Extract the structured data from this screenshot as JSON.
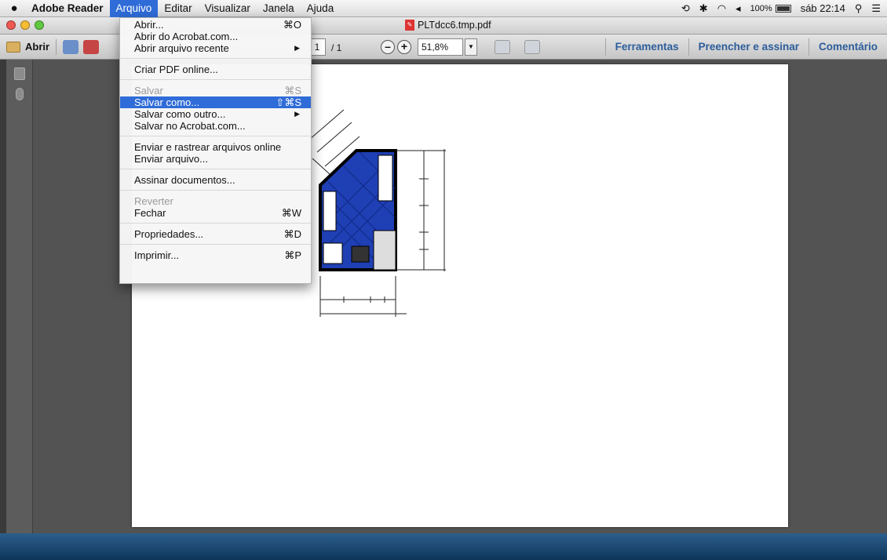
{
  "menubar": {
    "app_name": "Adobe Reader",
    "menus": [
      "Arquivo",
      "Editar",
      "Visualizar",
      "Janela",
      "Ajuda"
    ],
    "status": {
      "battery": "100%",
      "clock": "sáb 22:14"
    }
  },
  "window": {
    "title": "PLTdcc6.tmp.pdf"
  },
  "toolbar": {
    "open_label": "Abrir",
    "page_current": "1",
    "page_total": "/ 1",
    "zoom": "51,8%",
    "links": [
      "Ferramentas",
      "Preencher e assinar",
      "Comentário"
    ]
  },
  "file_menu": {
    "items": [
      {
        "label": "Abrir...",
        "shortcut": "⌘O"
      },
      {
        "label": "Abrir do Acrobat.com...",
        "shortcut": ""
      },
      {
        "label": "Abrir arquivo recente",
        "shortcut": ""
      },
      {
        "label": "Criar PDF online...",
        "shortcut": ""
      },
      {
        "label": "Salvar",
        "shortcut": "⌘S"
      },
      {
        "label": "Salvar como...",
        "shortcut": "⇧⌘S"
      },
      {
        "label": "Salvar como outro...",
        "shortcut": ""
      },
      {
        "label": "Salvar no Acrobat.com...",
        "shortcut": ""
      },
      {
        "label": "Enviar e rastrear arquivos online",
        "shortcut": ""
      },
      {
        "label": "Enviar arquivo...",
        "shortcut": ""
      },
      {
        "label": "Assinar documentos...",
        "shortcut": ""
      },
      {
        "label": "Reverter",
        "shortcut": ""
      },
      {
        "label": "Fechar",
        "shortcut": "⌘W"
      },
      {
        "label": "Propriedades...",
        "shortcut": "⌘D"
      },
      {
        "label": "Imprimir...",
        "shortcut": "⌘P"
      }
    ]
  },
  "colors": {
    "menu_highlight": "#2f6cd8",
    "floorplan_fill": "#1f3fb4",
    "toolbar_link": "#2c5d9b"
  }
}
